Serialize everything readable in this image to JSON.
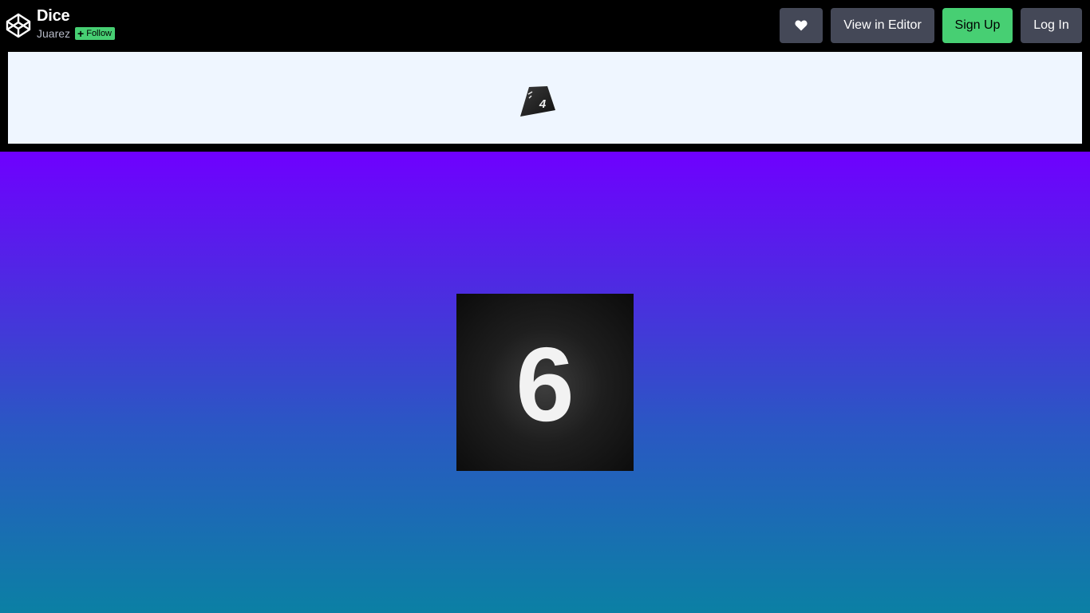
{
  "header": {
    "title": "Dice",
    "author": "Juarez",
    "follow_label": "Follow",
    "logo_icon": "codepen-logo-icon"
  },
  "actions": {
    "heart_icon": "heart-icon",
    "view_in_editor_label": "View in Editor",
    "sign_up_label": "Sign Up",
    "log_in_label": "Log In"
  },
  "preview": {
    "mini_die_value": "4"
  },
  "stage": {
    "die_value": "6"
  },
  "colors": {
    "accent_green": "#47cf73",
    "button_gray": "#444857",
    "gradient_top": "#6f00ff",
    "gradient_bottom": "#0b80a4"
  }
}
